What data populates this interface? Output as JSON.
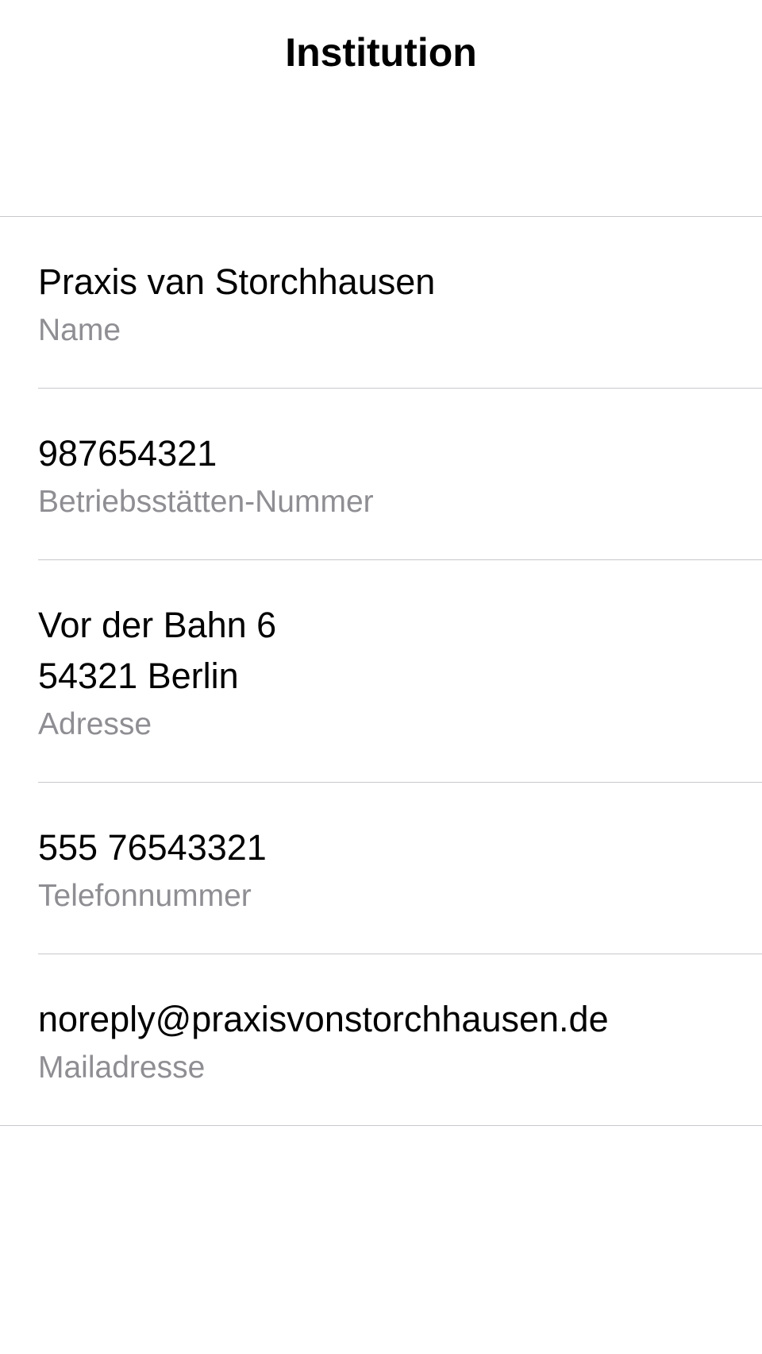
{
  "nav": {
    "title": "Institution"
  },
  "rows": [
    {
      "value": "Praxis van Storchhausen",
      "label": "Name"
    },
    {
      "value": "987654321",
      "label": "Betriebsstätten-Nummer"
    },
    {
      "value": "Vor der Bahn 6\n54321 Berlin",
      "label": "Adresse"
    },
    {
      "value": "555 76543321",
      "label": "Telefonnummer"
    },
    {
      "value": "noreply@praxisvonstorchhausen.de",
      "label": "Mailadresse"
    }
  ]
}
